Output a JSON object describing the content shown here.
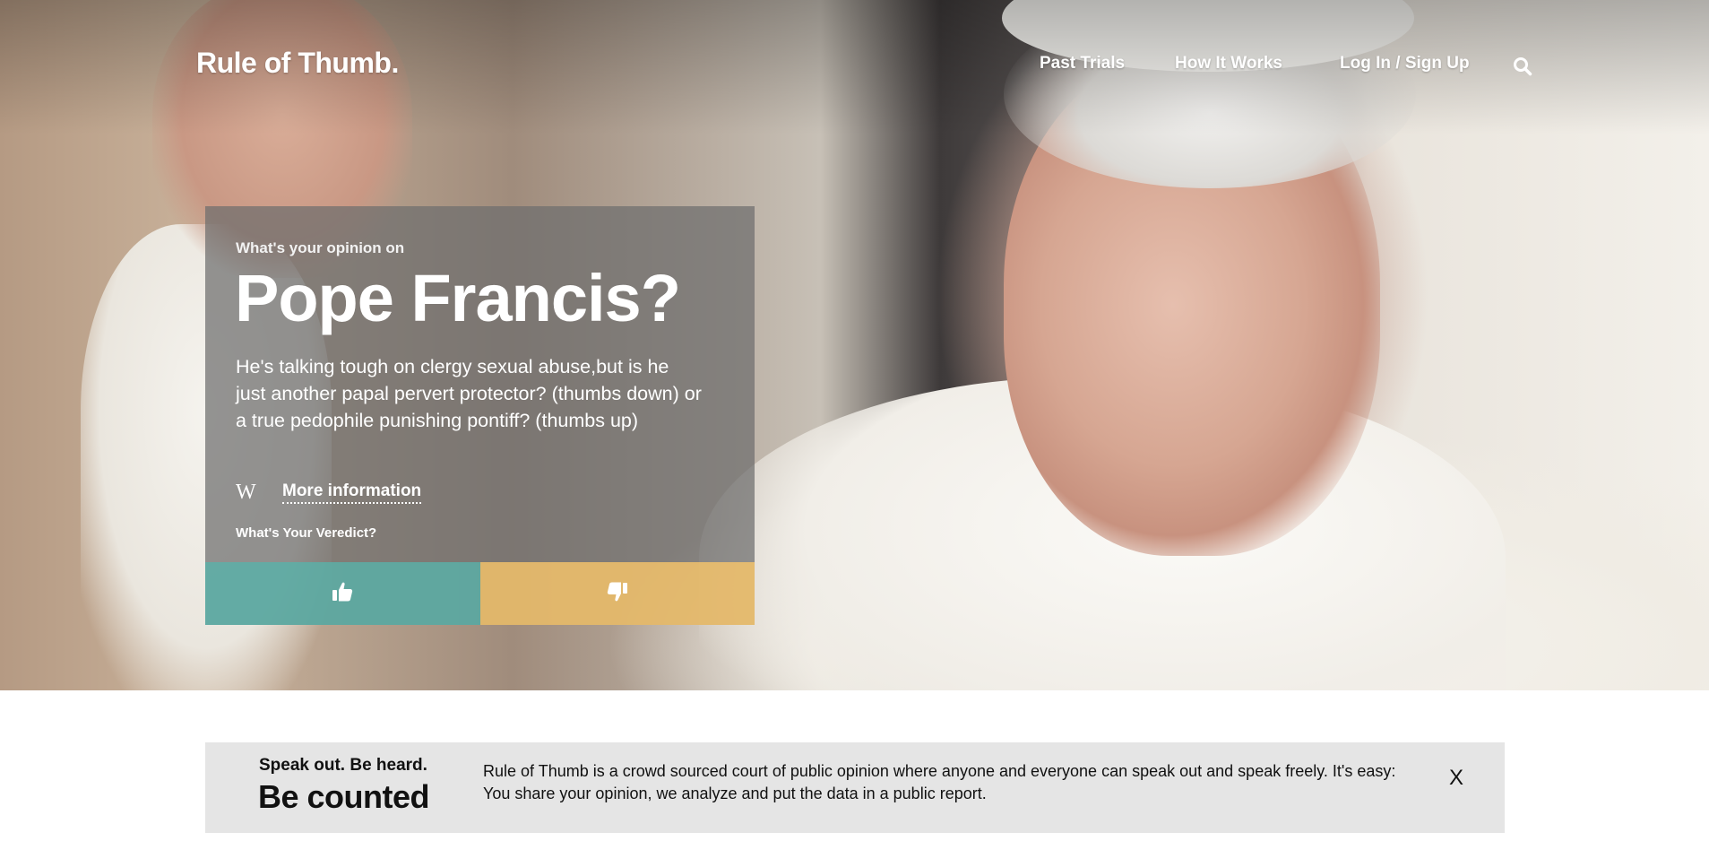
{
  "brand": "Rule of Thumb.",
  "nav": {
    "items": [
      {
        "label": "Past Trials"
      },
      {
        "label": "How It Works"
      },
      {
        "label": "Log In / Sign Up"
      }
    ],
    "search_icon": "search-icon"
  },
  "card": {
    "kicker": "What's your opinion on",
    "title": "Pope Francis?",
    "description": "He's talking tough on clergy sexual abuse,but is he just another papal pervert protector? (thumbs down) or a true pedophile punishing pontiff? (thumbs up)",
    "wiki_icon": "W",
    "more_info": "More information",
    "verdict": "What's Your Veredict?",
    "vote_up_icon": "thumbs-up-icon",
    "vote_down_icon": "thumbs-down-icon"
  },
  "banner": {
    "small": "Speak out. Be heard.",
    "big": "Be counted",
    "text": "Rule of Thumb is a crowd sourced court of public opinion where anyone and everyone can speak out and speak freely. It's easy: You share your opinion, we analyze and put the data in a public report.",
    "close": "X"
  },
  "colors": {
    "vote_up": "#5ca8a0",
    "vote_down": "#e4b86a",
    "banner_bg": "#e5e5e5"
  }
}
